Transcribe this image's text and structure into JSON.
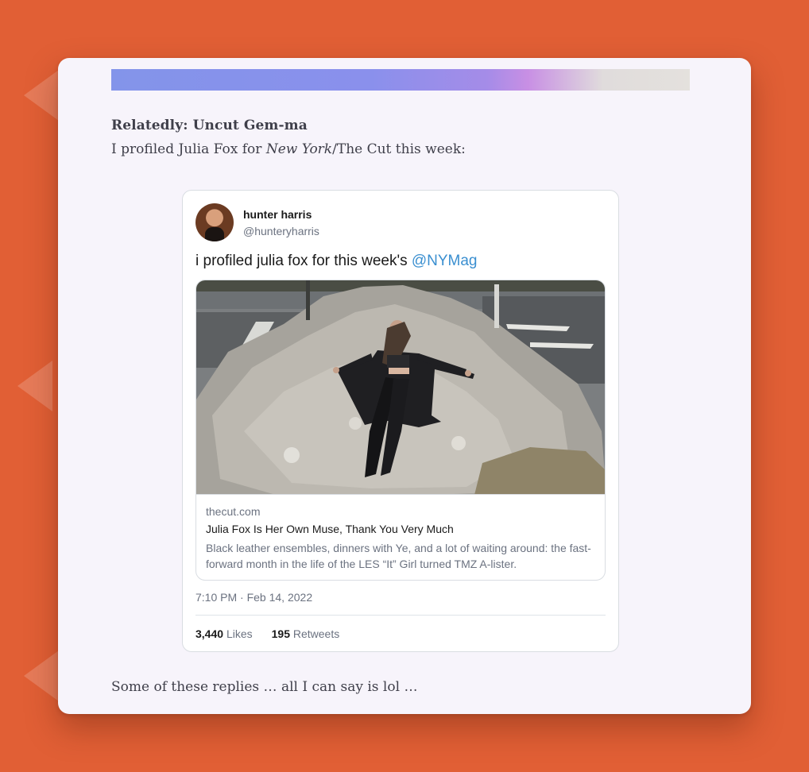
{
  "post": {
    "heading": "Relatedly: Uncut Gem-ma",
    "intro_before": "I profiled Julia Fox for ",
    "intro_italic": "New York",
    "intro_after": "/The Cut this week:",
    "footer": "Some of these replies … all I can say is lol …"
  },
  "tweet": {
    "author_name": "hunter harris",
    "author_handle": "@hunteryharris",
    "text": "i profiled julia fox for this week's ",
    "mention": "@NYMag",
    "link_card": {
      "domain": "thecut.com",
      "title": "Julia Fox Is Her Own Muse, Thank You Very Much",
      "description": "Black leather ensembles, dinners with Ye, and a lot of waiting around: the fast-forward month in the life of the LES “It” Girl turned TMZ A-lister."
    },
    "time": "7:10 PM",
    "separator": "·",
    "date": "Feb 14, 2022",
    "likes_count": "3,440",
    "likes_label": "Likes",
    "retweets_count": "195",
    "retweets_label": "Retweets"
  },
  "colors": {
    "background": "#e15f35",
    "card": "#f7f4fb",
    "mention": "#3a8fd0"
  }
}
